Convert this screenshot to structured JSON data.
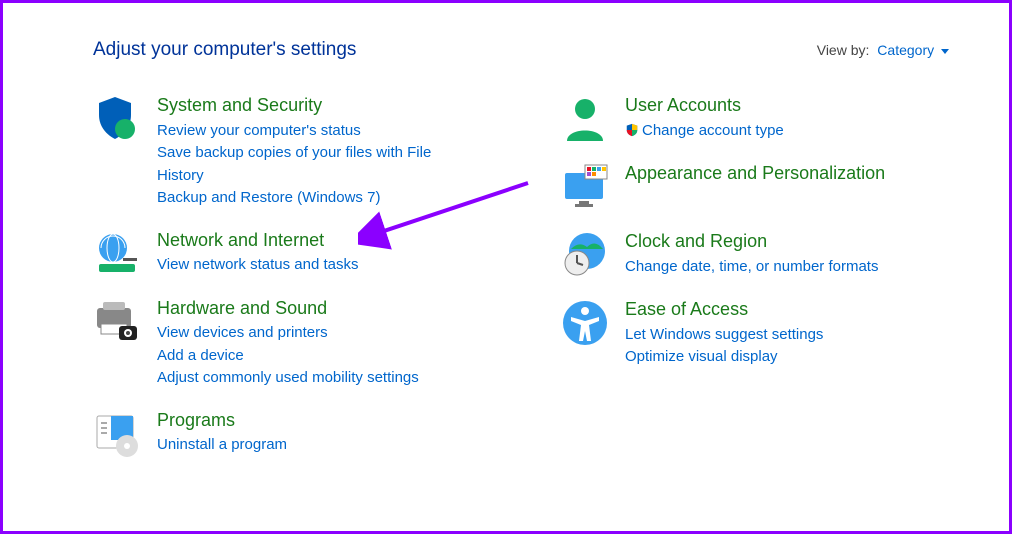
{
  "header": {
    "title": "Adjust your computer's settings",
    "view_by_label": "View by:",
    "view_by_value": "Category"
  },
  "categories": [
    {
      "id": "system-security",
      "title": "System and Security",
      "links": [
        "Review your computer's status",
        "Save backup copies of your files with File History",
        "Backup and Restore (Windows 7)"
      ]
    },
    {
      "id": "network-internet",
      "title": "Network and Internet",
      "links": [
        "View network status and tasks"
      ]
    },
    {
      "id": "hardware-sound",
      "title": "Hardware and Sound",
      "links": [
        "View devices and printers",
        "Add a device",
        "Adjust commonly used mobility settings"
      ]
    },
    {
      "id": "programs",
      "title": "Programs",
      "links": [
        "Uninstall a program"
      ]
    },
    {
      "id": "user-accounts",
      "title": "User Accounts",
      "links": [
        "Change account type"
      ]
    },
    {
      "id": "appearance",
      "title": "Appearance and Personalization",
      "links": []
    },
    {
      "id": "clock-region",
      "title": "Clock and Region",
      "links": [
        "Change date, time, or number formats"
      ]
    },
    {
      "id": "ease-access",
      "title": "Ease of Access",
      "links": [
        "Let Windows suggest settings",
        "Optimize visual display"
      ]
    }
  ]
}
